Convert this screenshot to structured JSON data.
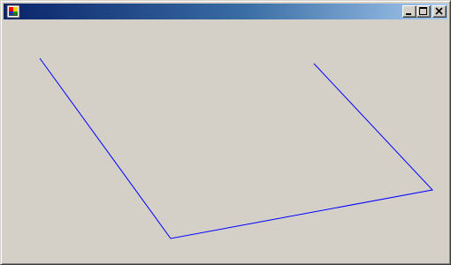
{
  "window": {
    "title": "",
    "titlebar_gradient": [
      "#0a246a",
      "#a6caf0"
    ],
    "face_color": "#d4d0c8"
  },
  "titlebar_buttons": [
    {
      "name": "minimize-button",
      "icon": "minimize-icon"
    },
    {
      "name": "maximize-button",
      "icon": "maximize-icon"
    },
    {
      "name": "close-button",
      "icon": "close-icon"
    }
  ],
  "app_icon": "application-icon",
  "drawing": {
    "stroke_color": "#0000ff"
  }
}
